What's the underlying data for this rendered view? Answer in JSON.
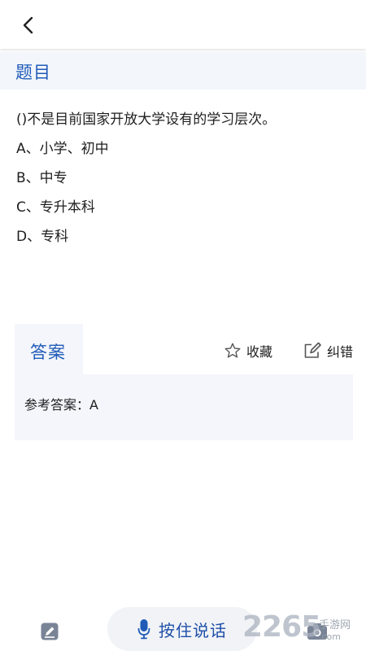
{
  "header": {
    "back_icon": "chevron-left-icon",
    "section_title": "题目"
  },
  "question": {
    "text": "()不是目前国家开放大学设有的学习层次。",
    "options": [
      "A、小学、初中",
      "B、中专",
      "C、专升本科",
      "D、专科"
    ]
  },
  "answer": {
    "tab_label": "答案",
    "favorite_label": "收藏",
    "correct_label": "纠错",
    "reference_text": "参考答案：A"
  },
  "bottom_bar": {
    "voice_label": "按住说话"
  },
  "watermark": {
    "number": "2265",
    "name": "手游网",
    "url": ".com"
  },
  "colors": {
    "accent": "#1f5bb7",
    "panel_bg": "#f4f6fb"
  }
}
